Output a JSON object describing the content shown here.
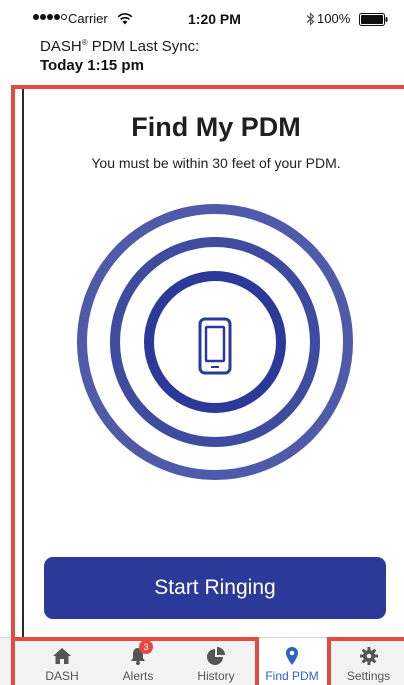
{
  "status_bar": {
    "carrier": "Carrier",
    "time": "1:20 PM",
    "battery": "100%",
    "icons": [
      "signal-dots",
      "wifi-icon",
      "bluetooth-icon",
      "battery-icon"
    ]
  },
  "header": {
    "sync_label_prefix": "DASH",
    "sync_label_suffix": " PDM Last Sync:",
    "sync_time": "Today 1:15 pm"
  },
  "main": {
    "title": "Find My PDM",
    "subtitle": "You must be within 30 feet of your PDM.",
    "button_label": "Start Ringing",
    "colors": {
      "ring_outer": "#4f5aa8",
      "ring_inner": "#2b3a99",
      "button": "#2b3a99",
      "annotation": "#e24a42"
    }
  },
  "tab_bar": {
    "tabs": [
      {
        "label": "DASH",
        "icon": "home-icon"
      },
      {
        "label": "Alerts",
        "icon": "bell-icon",
        "badge": "3"
      },
      {
        "label": "History",
        "icon": "pie-chart-icon"
      },
      {
        "label": "Find PDM",
        "icon": "location-pin-icon",
        "active": true
      },
      {
        "label": "Settings",
        "icon": "gear-icon"
      }
    ],
    "active_color": "#2b63c6"
  }
}
